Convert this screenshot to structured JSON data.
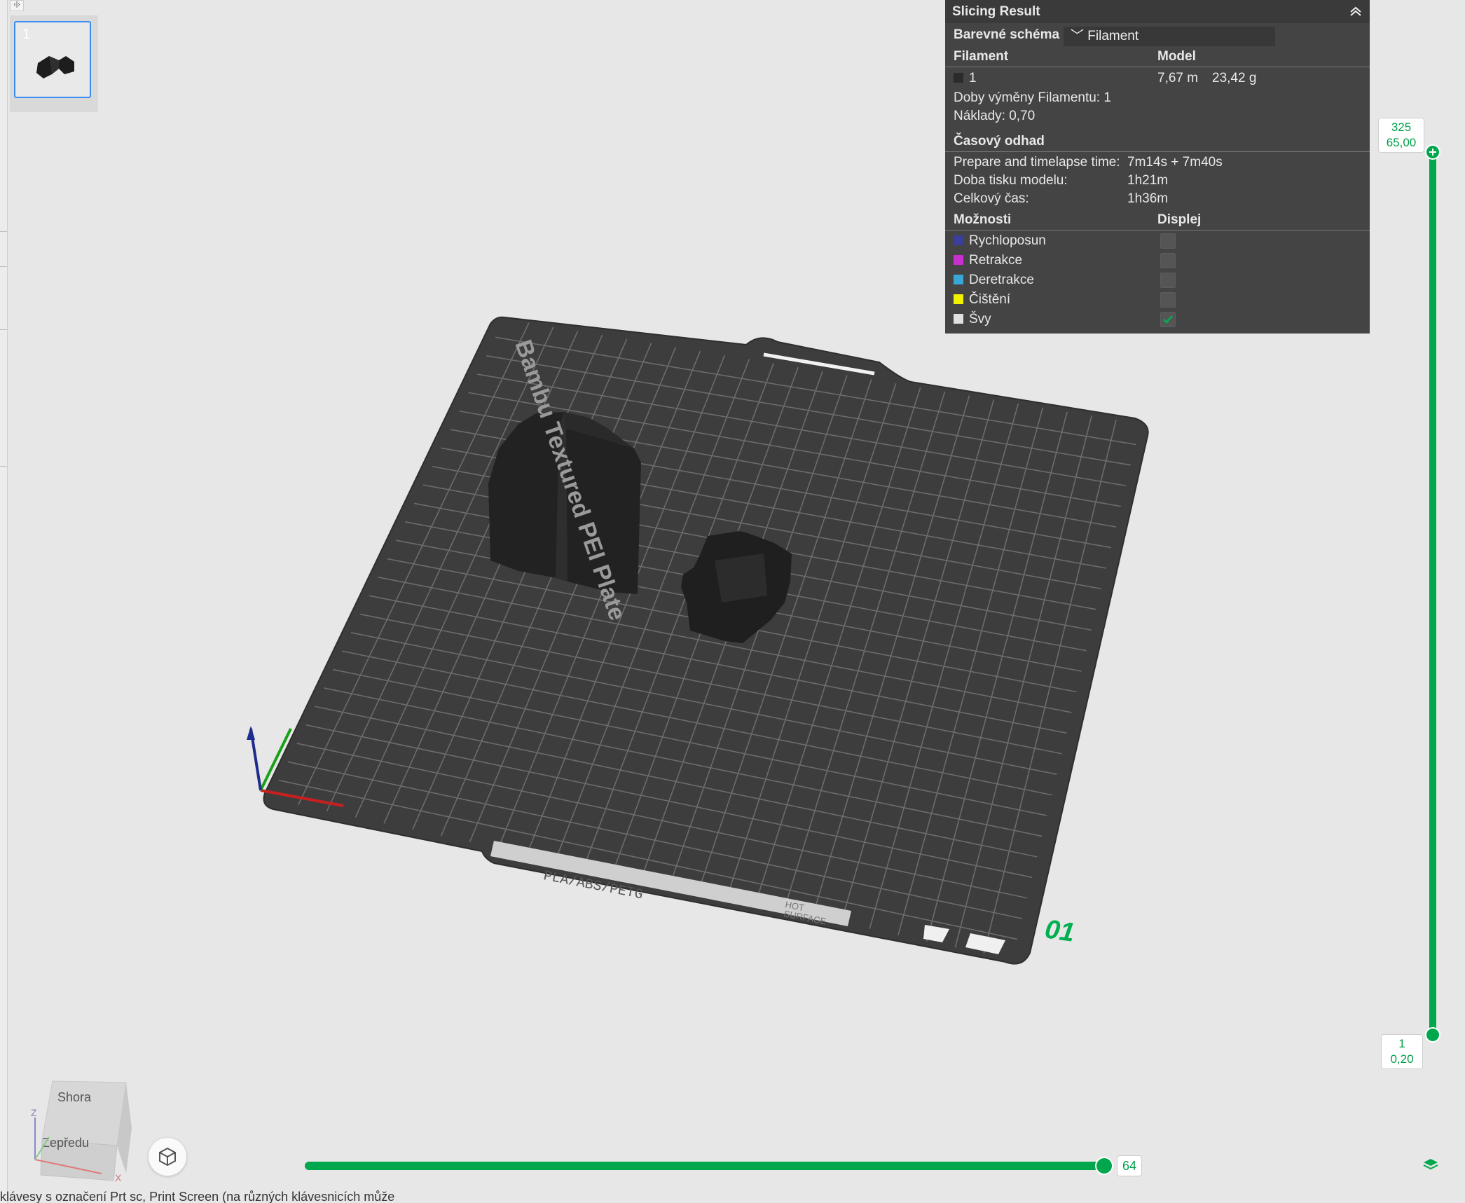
{
  "collapse_toggle": "‹|›",
  "plate": {
    "number": "1"
  },
  "slicing_result": {
    "title": "Slicing Result",
    "color_scheme_label": "Barevné schéma",
    "color_scheme_value": "Filament",
    "col_filament": "Filament",
    "col_model": "Model",
    "filament_row": {
      "id": "1",
      "length": "7,67 m",
      "weight": "23,42 g",
      "color": "#2b2b2b"
    },
    "changes_label": "Doby výměny Filamentu:",
    "changes_value": "1",
    "costs_label": "Náklady:",
    "costs_value": "0,70",
    "time_title": "Časový odhad",
    "prepare_label": "Prepare and timelapse time:",
    "prepare_value": "7m14s + 7m40s",
    "model_time_label": "Doba tisku modelu:",
    "model_time_value": "1h21m",
    "total_label": "Celkový čas:",
    "total_value": "1h36m",
    "options_title": "Možnosti",
    "display_title": "Displej",
    "options": [
      {
        "label": "Rychloposun",
        "color": "#3a3f9a",
        "checked": false
      },
      {
        "label": "Retrakce",
        "color": "#c72fd0",
        "checked": false
      },
      {
        "label": "Deretrakce",
        "color": "#3aa6d6",
        "checked": false
      },
      {
        "label": "Čištění",
        "color": "#f0f000",
        "checked": false
      },
      {
        "label": "Švy",
        "color": "#e0e0e0",
        "checked": true
      }
    ]
  },
  "layer_slider": {
    "top_layer": "325",
    "top_height": "65,00",
    "bottom_layer": "1",
    "bottom_height": "0,20"
  },
  "move_slider": {
    "value": "64"
  },
  "plate_scene": {
    "brand_text": "Bambu Textured PEI Plate",
    "material_text": "PLA/ABS/PETG",
    "hot_text_1": "HOT",
    "hot_text_2": "SURFACE",
    "plate_id": "01"
  },
  "nav_cube": {
    "top": "Shora",
    "front": "Zepředu",
    "axis_z": "Z",
    "axis_x": "X"
  },
  "bottom_text": "klávesy s označení Prt sc, Print Screen (na různých klávesnicích může"
}
